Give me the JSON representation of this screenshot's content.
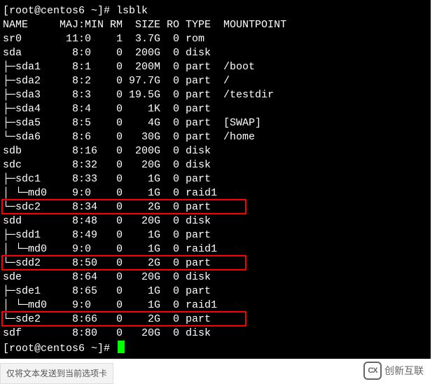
{
  "prompt1": "[root@centos6 ~]# ",
  "command1": "lsblk",
  "header": "NAME     MAJ:MIN RM  SIZE RO TYPE  MOUNTPOINT",
  "rows": [
    "sr0       11:0    1  3.7G  0 rom",
    "sda        8:0    0  200G  0 disk",
    "├─sda1     8:1    0  200M  0 part  /boot",
    "├─sda2     8:2    0 97.7G  0 part  /",
    "├─sda3     8:3    0 19.5G  0 part  /testdir",
    "├─sda4     8:4    0    1K  0 part",
    "├─sda5     8:5    0    4G  0 part  [SWAP]",
    "└─sda6     8:6    0   30G  0 part  /home",
    "sdb        8:16   0  200G  0 disk",
    "sdc        8:32   0   20G  0 disk",
    "├─sdc1     8:33   0    1G  0 part",
    "│ └─md0    9:0    0    1G  0 raid1",
    "└─sdc2     8:34   0    2G  0 part",
    "sdd        8:48   0   20G  0 disk",
    "├─sdd1     8:49   0    1G  0 part",
    "│ └─md0    9:0    0    1G  0 raid1",
    "└─sdd2     8:50   0    2G  0 part",
    "sde        8:64   0   20G  0 disk",
    "├─sde1     8:65   0    1G  0 part",
    "│ └─md0    9:0    0    1G  0 raid1",
    "└─sde2     8:66   0    2G  0 part",
    "sdf        8:80   0   20G  0 disk"
  ],
  "prompt2": "[root@centos6 ~]# ",
  "highlight_indices": [
    12,
    16,
    20
  ],
  "footer_tab": "仅将文本发送到当前选项卡",
  "footer_logo_text": "创新互联",
  "footer_logo_mark": "CX",
  "chart_data": {
    "type": "table",
    "title": "lsblk output",
    "columns": [
      "NAME",
      "MAJ:MIN",
      "RM",
      "SIZE",
      "RO",
      "TYPE",
      "MOUNTPOINT"
    ],
    "rows": [
      {
        "NAME": "sr0",
        "MAJ:MIN": "11:0",
        "RM": 1,
        "SIZE": "3.7G",
        "RO": 0,
        "TYPE": "rom",
        "MOUNTPOINT": ""
      },
      {
        "NAME": "sda",
        "MAJ:MIN": "8:0",
        "RM": 0,
        "SIZE": "200G",
        "RO": 0,
        "TYPE": "disk",
        "MOUNTPOINT": ""
      },
      {
        "NAME": "sda1",
        "MAJ:MIN": "8:1",
        "RM": 0,
        "SIZE": "200M",
        "RO": 0,
        "TYPE": "part",
        "MOUNTPOINT": "/boot"
      },
      {
        "NAME": "sda2",
        "MAJ:MIN": "8:2",
        "RM": 0,
        "SIZE": "97.7G",
        "RO": 0,
        "TYPE": "part",
        "MOUNTPOINT": "/"
      },
      {
        "NAME": "sda3",
        "MAJ:MIN": "8:3",
        "RM": 0,
        "SIZE": "19.5G",
        "RO": 0,
        "TYPE": "part",
        "MOUNTPOINT": "/testdir"
      },
      {
        "NAME": "sda4",
        "MAJ:MIN": "8:4",
        "RM": 0,
        "SIZE": "1K",
        "RO": 0,
        "TYPE": "part",
        "MOUNTPOINT": ""
      },
      {
        "NAME": "sda5",
        "MAJ:MIN": "8:5",
        "RM": 0,
        "SIZE": "4G",
        "RO": 0,
        "TYPE": "part",
        "MOUNTPOINT": "[SWAP]"
      },
      {
        "NAME": "sda6",
        "MAJ:MIN": "8:6",
        "RM": 0,
        "SIZE": "30G",
        "RO": 0,
        "TYPE": "part",
        "MOUNTPOINT": "/home"
      },
      {
        "NAME": "sdb",
        "MAJ:MIN": "8:16",
        "RM": 0,
        "SIZE": "200G",
        "RO": 0,
        "TYPE": "disk",
        "MOUNTPOINT": ""
      },
      {
        "NAME": "sdc",
        "MAJ:MIN": "8:32",
        "RM": 0,
        "SIZE": "20G",
        "RO": 0,
        "TYPE": "disk",
        "MOUNTPOINT": ""
      },
      {
        "NAME": "sdc1",
        "MAJ:MIN": "8:33",
        "RM": 0,
        "SIZE": "1G",
        "RO": 0,
        "TYPE": "part",
        "MOUNTPOINT": ""
      },
      {
        "NAME": "md0",
        "MAJ:MIN": "9:0",
        "RM": 0,
        "SIZE": "1G",
        "RO": 0,
        "TYPE": "raid1",
        "MOUNTPOINT": ""
      },
      {
        "NAME": "sdc2",
        "MAJ:MIN": "8:34",
        "RM": 0,
        "SIZE": "2G",
        "RO": 0,
        "TYPE": "part",
        "MOUNTPOINT": ""
      },
      {
        "NAME": "sdd",
        "MAJ:MIN": "8:48",
        "RM": 0,
        "SIZE": "20G",
        "RO": 0,
        "TYPE": "disk",
        "MOUNTPOINT": ""
      },
      {
        "NAME": "sdd1",
        "MAJ:MIN": "8:49",
        "RM": 0,
        "SIZE": "1G",
        "RO": 0,
        "TYPE": "part",
        "MOUNTPOINT": ""
      },
      {
        "NAME": "md0",
        "MAJ:MIN": "9:0",
        "RM": 0,
        "SIZE": "1G",
        "RO": 0,
        "TYPE": "raid1",
        "MOUNTPOINT": ""
      },
      {
        "NAME": "sdd2",
        "MAJ:MIN": "8:50",
        "RM": 0,
        "SIZE": "2G",
        "RO": 0,
        "TYPE": "part",
        "MOUNTPOINT": ""
      },
      {
        "NAME": "sde",
        "MAJ:MIN": "8:64",
        "RM": 0,
        "SIZE": "20G",
        "RO": 0,
        "TYPE": "disk",
        "MOUNTPOINT": ""
      },
      {
        "NAME": "sde1",
        "MAJ:MIN": "8:65",
        "RM": 0,
        "SIZE": "1G",
        "RO": 0,
        "TYPE": "part",
        "MOUNTPOINT": ""
      },
      {
        "NAME": "md0",
        "MAJ:MIN": "9:0",
        "RM": 0,
        "SIZE": "1G",
        "RO": 0,
        "TYPE": "raid1",
        "MOUNTPOINT": ""
      },
      {
        "NAME": "sde2",
        "MAJ:MIN": "8:66",
        "RM": 0,
        "SIZE": "2G",
        "RO": 0,
        "TYPE": "part",
        "MOUNTPOINT": ""
      },
      {
        "NAME": "sdf",
        "MAJ:MIN": "8:80",
        "RM": 0,
        "SIZE": "20G",
        "RO": 0,
        "TYPE": "disk",
        "MOUNTPOINT": ""
      }
    ]
  }
}
